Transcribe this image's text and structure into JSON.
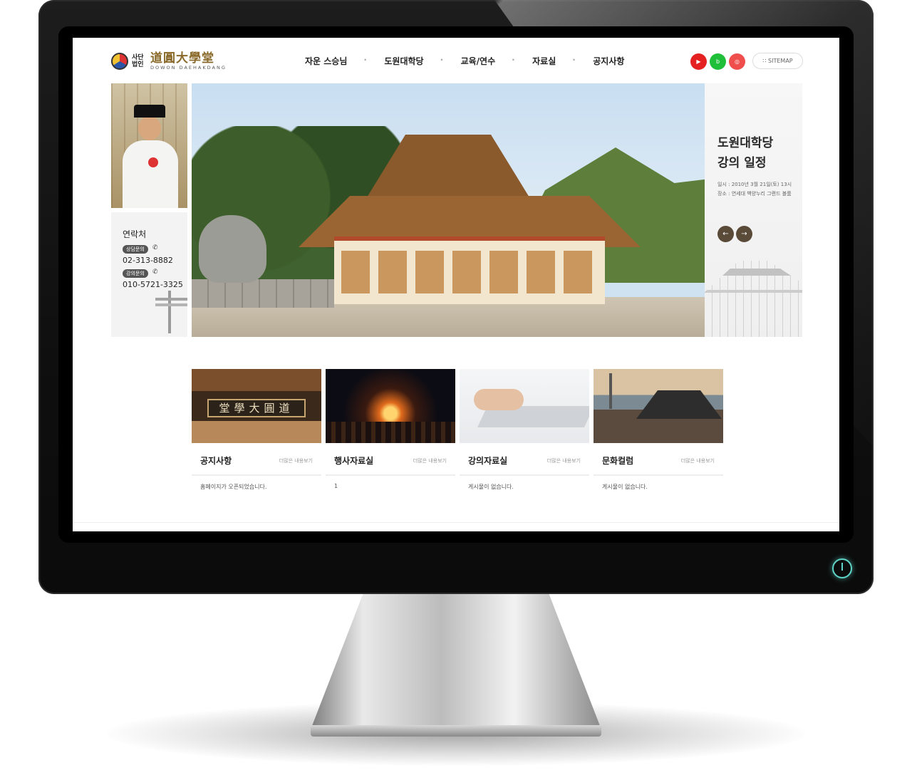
{
  "logo": {
    "small": "사단법인",
    "hanja": "道圓大學堂",
    "english": "DOWON DAEHAKDANG"
  },
  "nav": [
    "자운 스승님",
    "도원대학당",
    "교육/연수",
    "자료실",
    "공지사항"
  ],
  "sitemap": "SITEMAP",
  "contact": {
    "title": "연락처",
    "items": [
      {
        "badge": "상담문의",
        "number": "02-313-8882"
      },
      {
        "badge": "강의문의",
        "number": "010-5721-3325"
      }
    ]
  },
  "schedule": {
    "title_line1": "도원대학당",
    "title_line2": "강의 일정",
    "date": "일시 : 2010년 3월 21일(토) 13시",
    "place": "장소 : 연세대 백양누리 그랜드 볼룸"
  },
  "plaque_text": "堂學大圓道",
  "cards": [
    {
      "title": "공지사항",
      "more": "더많은 내용보기",
      "text": "홈페이지가 오픈되었습니다."
    },
    {
      "title": "행사자료실",
      "more": "더많은 내용보기",
      "text": "1"
    },
    {
      "title": "강의자료실",
      "more": "더많은 내용보기",
      "text": "게시물이 없습니다."
    },
    {
      "title": "문화컬럼",
      "more": "더많은 내용보기",
      "text": "게시물이 없습니다."
    }
  ],
  "icons": {
    "youtube": "youtube-icon",
    "blog": "blog-icon",
    "instagram": "instagram-icon",
    "prev": "arrow-left-icon",
    "next": "arrow-right-icon",
    "phone": "phone-icon",
    "power": "power-icon"
  },
  "colors": {
    "accent_brown": "#5a4a38",
    "logo_gold": "#8a6a2a",
    "youtube": "#e52020",
    "blog": "#1fbf3a",
    "instagram": "#f04d4d"
  }
}
